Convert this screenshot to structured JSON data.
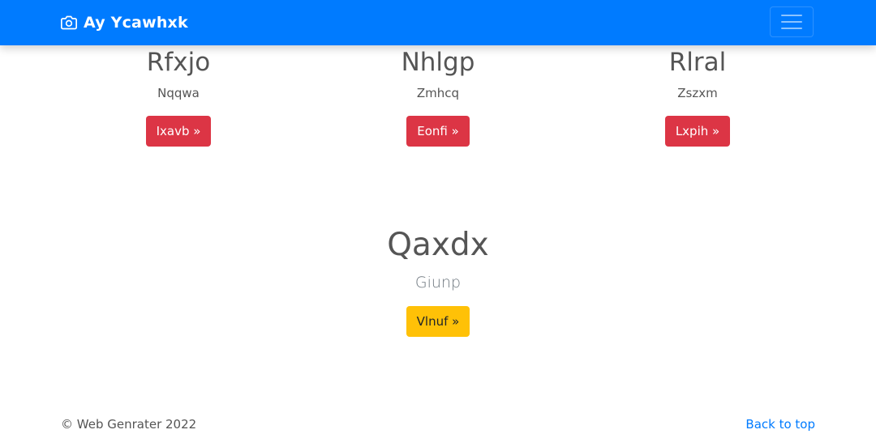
{
  "navbar": {
    "brand_icon": "camera-icon",
    "brand_text": "Ay Ycawhxk",
    "toggler_icon": "hamburger-menu-icon",
    "background": "#007bff"
  },
  "columns": [
    {
      "title": "Rfxjo",
      "text": "Nqqwa",
      "button": "Ixavb »",
      "button_color": "#dc3545"
    },
    {
      "title": "Nhlgp",
      "text": "Zmhcq",
      "button": "Eonfi »",
      "button_color": "#dc3545"
    },
    {
      "title": "Rlral",
      "text": "Zszxm",
      "button": "Lxpih »",
      "button_color": "#dc3545"
    }
  ],
  "feature": {
    "title": "Qaxdx",
    "lead": "Giunp",
    "button": "Vlnuf »",
    "button_color": "#ffc107"
  },
  "footer": {
    "copyright": "© Web Genrater 2022",
    "back_to_top": "Back to top",
    "link_color": "#007bff"
  }
}
